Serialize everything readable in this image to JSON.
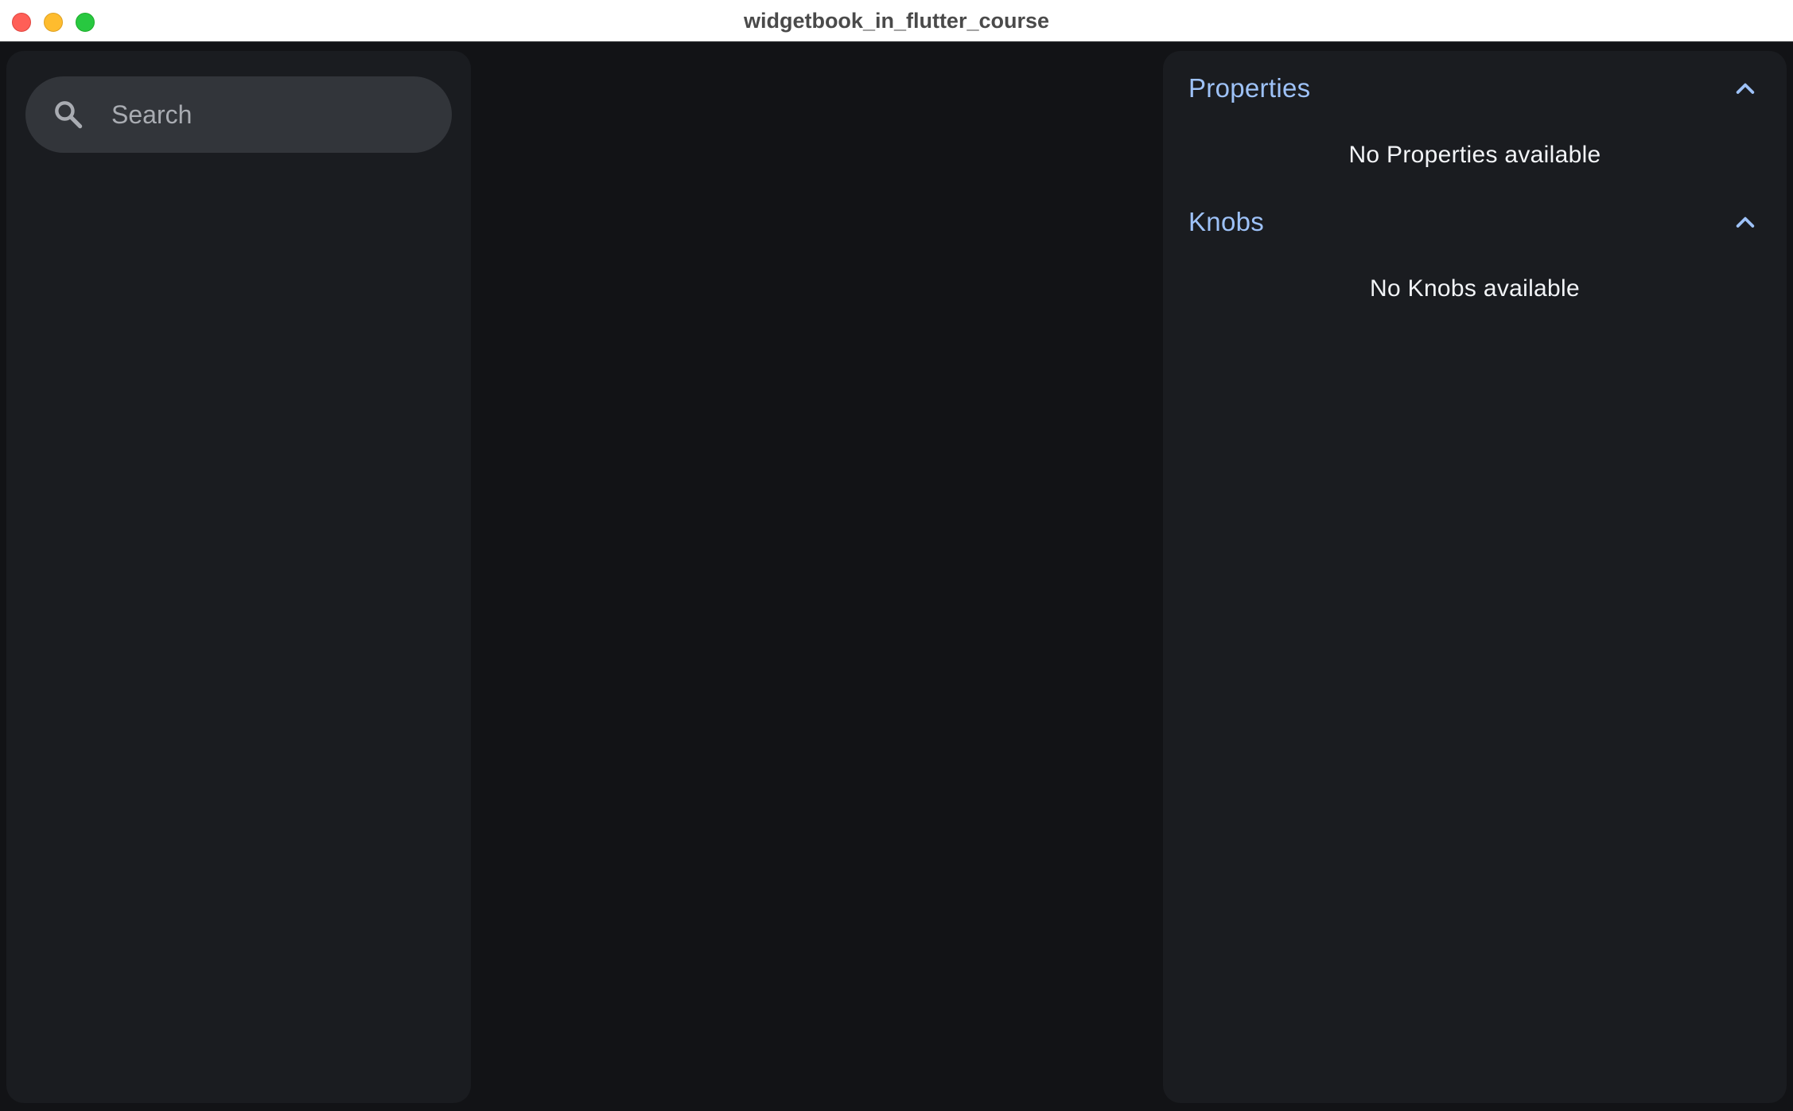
{
  "window": {
    "title": "widgetbook_in_flutter_course"
  },
  "navigation": {
    "search": {
      "placeholder": "Search",
      "value": "",
      "icon": "search-icon"
    }
  },
  "addons": {
    "properties": {
      "title": "Properties",
      "empty_message": "No Properties available",
      "expanded": true,
      "icon": "chevron-up-icon"
    },
    "knobs": {
      "title": "Knobs",
      "empty_message": "No Knobs available",
      "expanded": true,
      "icon": "chevron-up-icon"
    }
  },
  "colors": {
    "accent": "#9ec2f8",
    "panel": "#1a1c20",
    "background": "#121316",
    "search_fill": "#32353a"
  }
}
